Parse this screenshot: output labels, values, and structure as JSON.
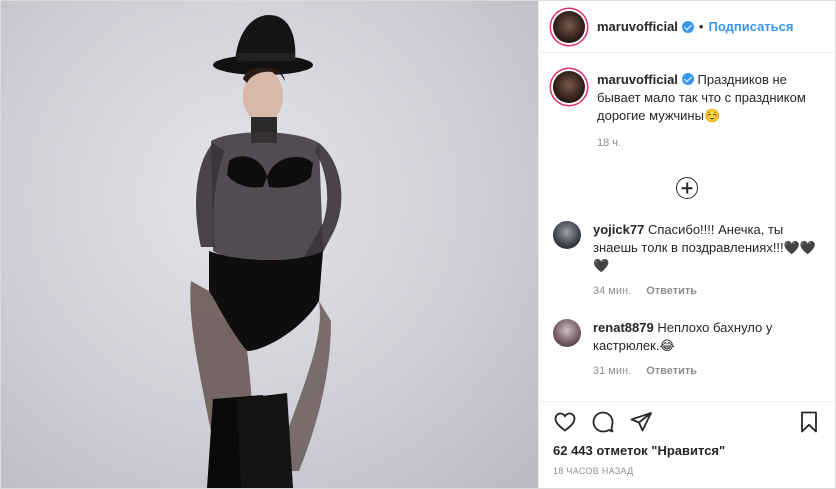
{
  "post": {
    "image_alt": "photo",
    "header": {
      "username": "maruvofficial",
      "separator": "•",
      "follow_label": "Подписаться"
    },
    "caption": {
      "username": "maruvofficial",
      "text": "Праздников не бывает мало так что с праздником дорогие мужчины☺️",
      "time": "18 ч."
    },
    "comments": [
      {
        "username": "yojick77",
        "text": "Спасибо!!!! Анечка, ты знаешь толк в поздравлениях!!!🖤🖤🖤",
        "time": "34 мин.",
        "reply_label": "Ответить"
      },
      {
        "username": "renat8879",
        "text": "Неплохо бахнуло у кастрюлек.😂",
        "time": "31 мин.",
        "reply_label": "Ответить"
      }
    ],
    "likes_text": "62 443 отметок \"Нравится\"",
    "posted_ago": "18 часов назад"
  },
  "colors": {
    "link_blue": "#3897f0",
    "border": "#efefef",
    "muted": "#8e8e8e",
    "text": "#262626"
  },
  "icons": {
    "like": "heart-icon",
    "comment": "comment-bubble-icon",
    "share": "paper-plane-icon",
    "save": "bookmark-icon",
    "load_more": "plus-circle-icon",
    "verified": "verified-badge-icon"
  }
}
